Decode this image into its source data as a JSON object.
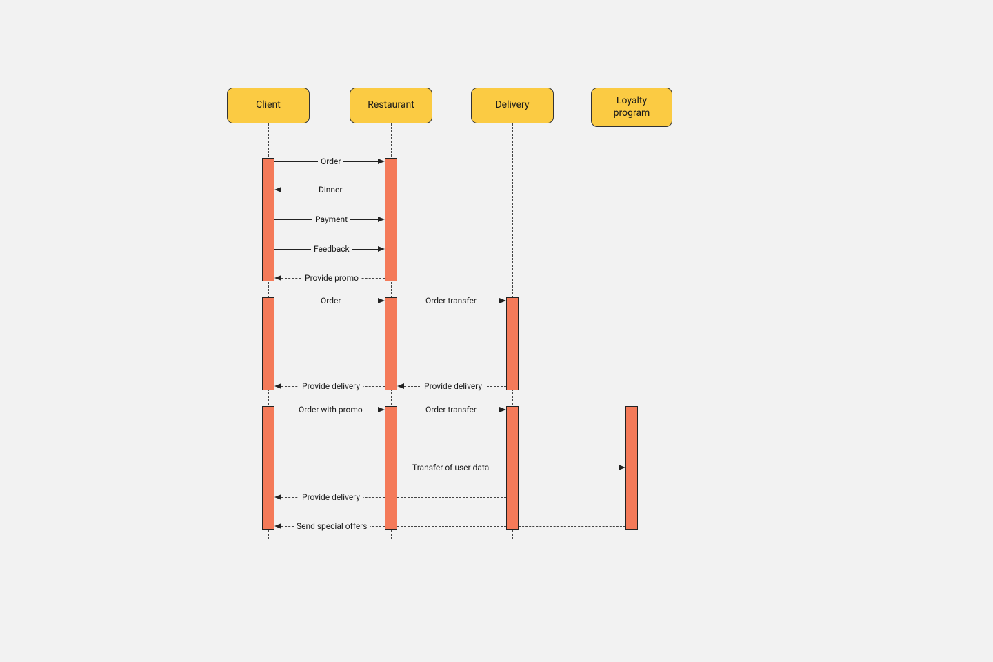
{
  "diagram": {
    "type": "uml-sequence",
    "actors": {
      "client": "Client",
      "restaurant": "Restaurant",
      "delivery": "Delivery",
      "loyalty": "Loyalty program"
    },
    "messages": {
      "m1": "Order",
      "m2": "Dinner",
      "m3": "Payment",
      "m4": "Feedback",
      "m5": "Provide promo",
      "m6": "Order",
      "m7": "Order transfer",
      "m8a": "Provide delivery",
      "m8b": "Provide delivery",
      "m9": "Order with promo",
      "m10": "Order transfer",
      "m11": "Transfer of user data",
      "m12": "Provide delivery",
      "m13": "Send special offers"
    },
    "colors": {
      "actor_fill": "#fbcb43",
      "activation_fill": "#f47a59",
      "background": "#f2f2f2"
    }
  }
}
